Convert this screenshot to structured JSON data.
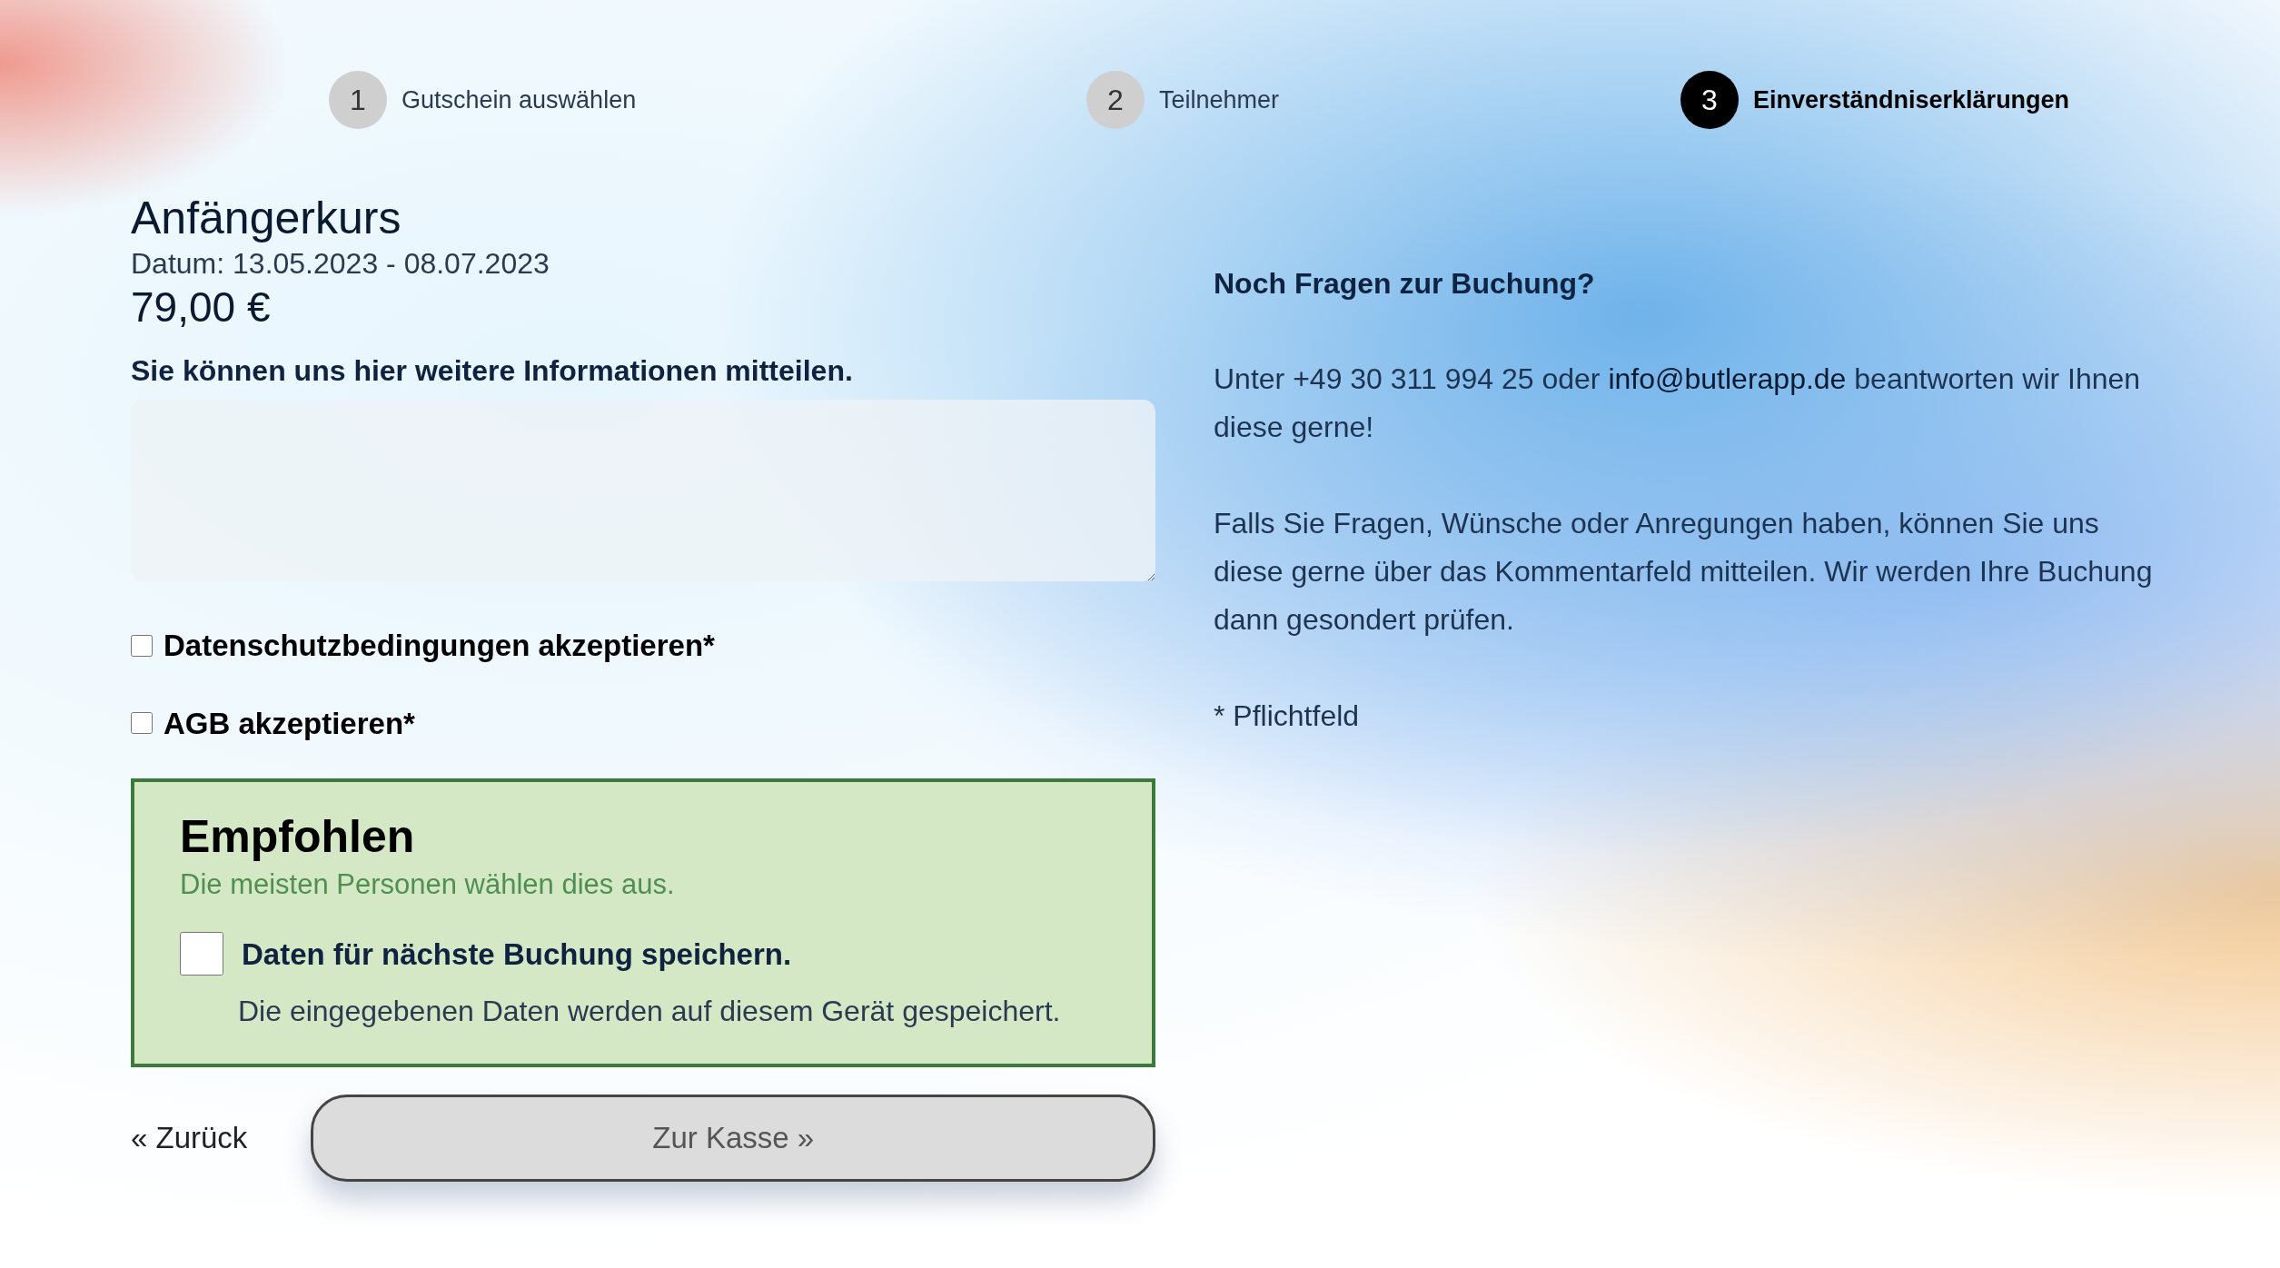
{
  "steps": [
    {
      "number": "1",
      "label": "Gutschein auswählen",
      "selected": false
    },
    {
      "number": "2",
      "label": "Teilnehmer",
      "selected": false
    },
    {
      "number": "3",
      "label": "Einverständniserklärungen",
      "selected": true
    }
  ],
  "course": {
    "title": "Anfängerkurs",
    "date": "Datum: 13.05.2023 - 08.07.2023",
    "price": "79,00 €"
  },
  "comment": {
    "label": "Sie können uns hier weitere Informationen mitteilen."
  },
  "consents": [
    {
      "label": "Datenschutzbedingungen akzeptieren*",
      "checked": false
    },
    {
      "label": "AGB akzeptieren*",
      "checked": false
    }
  ],
  "recommended": {
    "title": "Empfohlen",
    "subtitle": "Die meisten Personen wählen dies aus.",
    "checkbox_label": "Daten für nächste Buchung speichern.",
    "checked": false,
    "description": "Die eingegebenen Daten werden auf diesem Gerät gespeichert."
  },
  "back_link": "« Zurück",
  "checkout_button": "Zur Kasse »",
  "help": {
    "heading": "Noch Fragen zur Buchung?",
    "contact_before": "Unter +49 30 311 994 25 oder ",
    "contact_link": "info@butlerapp.de",
    "contact_after": " beantworten wir Ihnen diese gerne!",
    "paragraph": "Falls Sie Fragen, Wünsche oder Anregungen haben, können Sie uns diese gerne über das Kommentarfeld mitteilen. Wir werden Ihre Buchung dann gesondert prüfen.",
    "footnote": "* Pflichtfeld"
  }
}
